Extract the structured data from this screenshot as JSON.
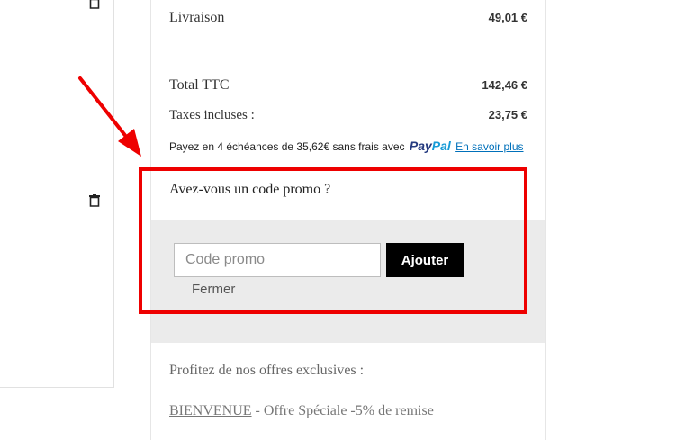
{
  "summary": {
    "shipping": {
      "label": "Livraison",
      "value": "49,01 €"
    },
    "total": {
      "label": "Total TTC",
      "value": "142,46 €"
    },
    "taxes": {
      "label": "Taxes incluses :",
      "value": "23,75 €"
    }
  },
  "paypal": {
    "text": "Payez en 4 échéances de 35,62€ sans frais avec",
    "logo_pay": "Pay",
    "logo_pal": "Pal",
    "link": "En savoir plus"
  },
  "promo": {
    "heading": "Avez-vous un code promo ?",
    "placeholder": "Code promo",
    "value": "",
    "button": "Ajouter",
    "close": "Fermer"
  },
  "offers": {
    "title": "Profitez de nos offres exclusives :",
    "items": [
      {
        "code": "BIENVENUE",
        "description": " - Offre Spéciale -5% de remise"
      }
    ]
  },
  "icons": {
    "delete": "trash-icon",
    "annotation": "red-arrow-icon"
  },
  "colors": {
    "annotation": "#ee0000",
    "button_bg": "#000000",
    "promo_bg": "#ebebeb",
    "paypal_dark": "#253b80",
    "paypal_light": "#179bd7",
    "link": "#0070ba"
  }
}
